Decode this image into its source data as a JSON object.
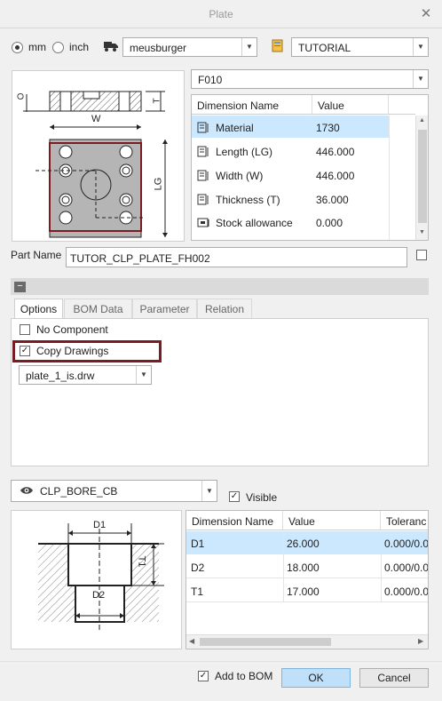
{
  "window": {
    "title": "Plate",
    "close_glyph": "✕"
  },
  "units": {
    "mm_label": "mm",
    "inch_label": "inch",
    "selected": "mm"
  },
  "supplier_select": {
    "value": "meusburger",
    "icon": "truck-icon"
  },
  "catalog_select": {
    "value": "TUTORIAL",
    "icon": "catalog-icon"
  },
  "type_select": {
    "value": "F010"
  },
  "plate_preview": {
    "w_label": "W",
    "t_label": "T",
    "lg_label": "LG",
    "o_label": "O"
  },
  "dimensions_table": {
    "columns": [
      "Dimension Name",
      "Value"
    ],
    "rows": [
      {
        "name": "Material",
        "value": "1730",
        "selected": true
      },
      {
        "name": "Length (LG)",
        "value": "446.000"
      },
      {
        "name": "Width (W)",
        "value": "446.000"
      },
      {
        "name": "Thickness (T)",
        "value": "36.000"
      },
      {
        "name": "Stock allowance",
        "value": "0.000"
      }
    ]
  },
  "part_name": {
    "label": "Part Name",
    "value": "TUTOR_CLP_PLATE_FH002"
  },
  "collapse_glyph": "−",
  "tabs": [
    "Options",
    "BOM Data",
    "Parameter",
    "Relation"
  ],
  "options": {
    "no_component_label": "No Component",
    "copy_drawings_label": "Copy Drawings",
    "drawing_select_value": "plate_1_is.drw"
  },
  "feature": {
    "select_value": "CLP_BORE_CB",
    "visible_label": "Visible",
    "eye_icon": "eye-icon"
  },
  "bore_preview": {
    "d1_label": "D1",
    "d2_label": "D2",
    "t1_label": "T1"
  },
  "feature_table": {
    "columns": [
      "Dimension Name",
      "Value",
      "Toleranc"
    ],
    "rows": [
      {
        "name": "D1",
        "value": "26.000",
        "tol": "0.000/0.0",
        "selected": true
      },
      {
        "name": "D2",
        "value": "18.000",
        "tol": "0.000/0.0"
      },
      {
        "name": "T1",
        "value": "17.000",
        "tol": "0.000/0.0"
      }
    ]
  },
  "footer": {
    "add_to_bom_label": "Add to BOM",
    "ok_label": "OK",
    "cancel_label": "Cancel"
  },
  "colors": {
    "selection": "#cce8ff",
    "highlight_box": "#7a1c24",
    "plate_fill": "#b5b5b5"
  }
}
